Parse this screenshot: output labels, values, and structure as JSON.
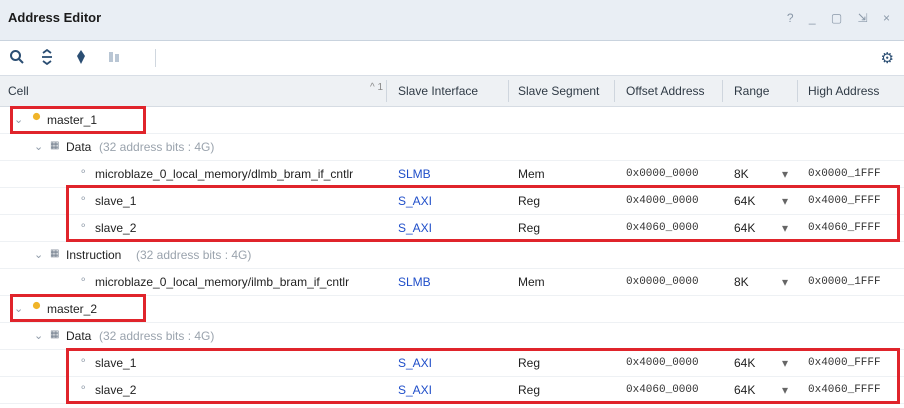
{
  "window": {
    "title": "Address Editor",
    "controls": "? _ ▢ ⇲ ×"
  },
  "toolbar": {
    "icons": [
      "search-icon",
      "collapse-all-icon",
      "expand-icon",
      "assign-address-icon",
      "settings-icon"
    ]
  },
  "columns": [
    "Cell",
    "Slave Interface",
    "Slave Segment",
    "Offset Address",
    "Range",
    "High Address"
  ],
  "sort_indicator": "^ 1",
  "rows": [
    {
      "type": "master",
      "label": "master_1"
    },
    {
      "type": "space",
      "label": "Data",
      "note": "(32 address bits : 4G)"
    },
    {
      "type": "slave",
      "label": "microblaze_0_local_memory/dlmb_bram_if_cntlr",
      "iface": "SLMB",
      "segment": "Mem",
      "offset": "0x0000_0000",
      "range": "8K",
      "high": "0x0000_1FFF"
    },
    {
      "type": "slave",
      "label": "slave_1",
      "iface": "S_AXI",
      "segment": "Reg",
      "offset": "0x4000_0000",
      "range": "64K",
      "high": "0x4000_FFFF"
    },
    {
      "type": "slave",
      "label": "slave_2",
      "iface": "S_AXI",
      "segment": "Reg",
      "offset": "0x4060_0000",
      "range": "64K",
      "high": "0x4060_FFFF"
    },
    {
      "type": "space",
      "label": "Instruction",
      "note": "(32 address bits : 4G)"
    },
    {
      "type": "slave",
      "label": "microblaze_0_local_memory/ilmb_bram_if_cntlr",
      "iface": "SLMB",
      "segment": "Mem",
      "offset": "0x0000_0000",
      "range": "8K",
      "high": "0x0000_1FFF"
    },
    {
      "type": "master",
      "label": "master_2"
    },
    {
      "type": "space",
      "label": "Data",
      "note": "(32 address bits : 4G)"
    },
    {
      "type": "slave",
      "label": "slave_1",
      "iface": "S_AXI",
      "segment": "Reg",
      "offset": "0x4000_0000",
      "range": "64K",
      "high": "0x4000_FFFF"
    },
    {
      "type": "slave",
      "label": "slave_2",
      "iface": "S_AXI",
      "segment": "Reg",
      "offset": "0x4060_0000",
      "range": "64K",
      "high": "0x4060_FFFF"
    }
  ],
  "glyphs": {
    "expanded": "⌄",
    "leaf": "⚬",
    "range_dropdown": "▾",
    "space": "▦"
  },
  "colors": {
    "highlight": "#e0242b",
    "link": "#1f4ec9",
    "master_icon": "#f0b429"
  }
}
